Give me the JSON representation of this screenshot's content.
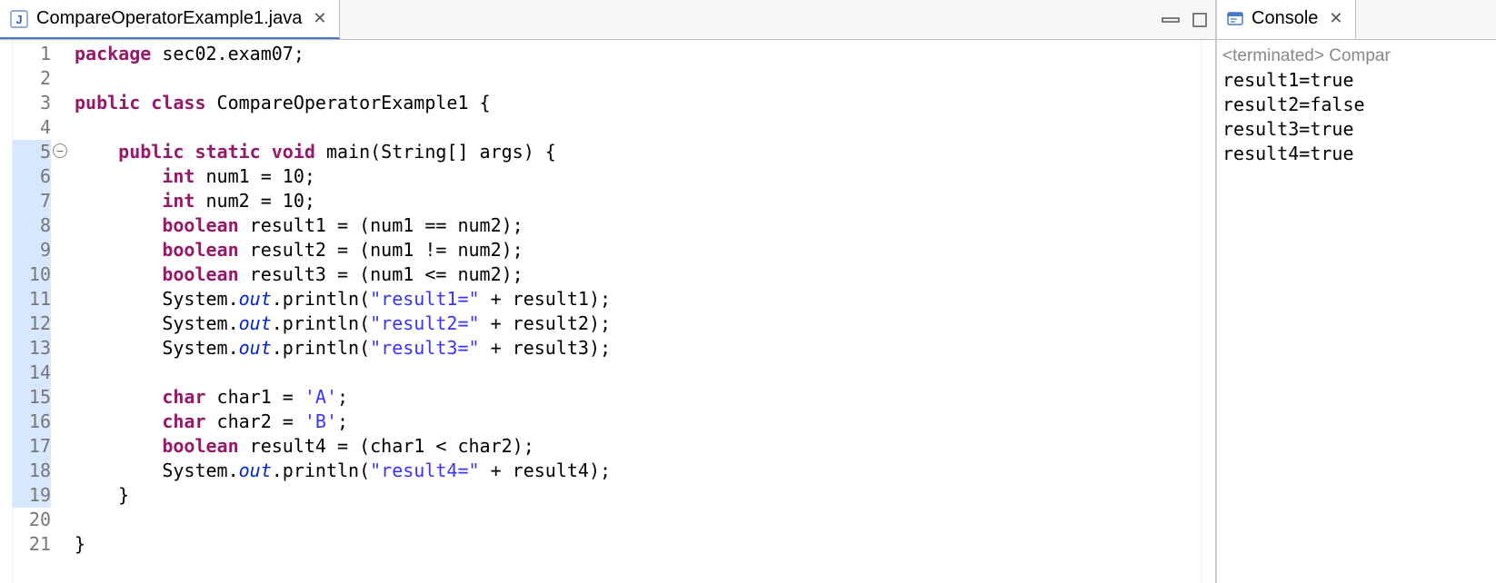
{
  "editor": {
    "tab": {
      "label": "CompareOperatorExample1.java"
    },
    "lines": [
      {
        "n": "1"
      },
      {
        "n": "2"
      },
      {
        "n": "3"
      },
      {
        "n": "4"
      },
      {
        "n": "5"
      },
      {
        "n": "6"
      },
      {
        "n": "7"
      },
      {
        "n": "8"
      },
      {
        "n": "9"
      },
      {
        "n": "10"
      },
      {
        "n": "11"
      },
      {
        "n": "12"
      },
      {
        "n": "13"
      },
      {
        "n": "14"
      },
      {
        "n": "15"
      },
      {
        "n": "16"
      },
      {
        "n": "17"
      },
      {
        "n": "18"
      },
      {
        "n": "19"
      },
      {
        "n": "20"
      },
      {
        "n": "21"
      }
    ],
    "code": {
      "l1_kw1": "package",
      "l1_rest": " sec02.exam07;",
      "l3_kw1": "public",
      "l3_kw2": "class",
      "l3_rest": " CompareOperatorExample1 {",
      "l5_kw1": "public",
      "l5_kw2": "static",
      "l5_kw3": "void",
      "l5_m": " main(String[] args) {",
      "l6_kw": "int",
      "l6_rest": " num1 = 10;",
      "l7_kw": "int",
      "l7_rest": " num2 = 10;",
      "l8_kw": "boolean",
      "l8_rest": " result1 = (num1 == num2);",
      "l9_kw": "boolean",
      "l9_rest": " result2 = (num1 != num2);",
      "l10_kw": "boolean",
      "l10_rest": " result3 = (num1 <= num2);",
      "l11_a": "        System.",
      "l11_out": "out",
      "l11_b": ".println(",
      "l11_s": "\"result1=\"",
      "l11_c": " + result1);",
      "l12_a": "        System.",
      "l12_out": "out",
      "l12_b": ".println(",
      "l12_s": "\"result2=\"",
      "l12_c": " + result2);",
      "l13_a": "        System.",
      "l13_out": "out",
      "l13_b": ".println(",
      "l13_s": "\"result3=\"",
      "l13_c": " + result3);",
      "l15_kw": "char",
      "l15_rest_a": " char1 = ",
      "l15_s": "'A'",
      "l15_rest_b": ";",
      "l16_kw": "char",
      "l16_rest_a": " char2 = ",
      "l16_s": "'B'",
      "l16_rest_b": ";",
      "l17_kw": "boolean",
      "l17_rest": " result4 = (char1 < char2);",
      "l18_a": "        System.",
      "l18_out": "out",
      "l18_b": ".println(",
      "l18_s": "\"result4=\"",
      "l18_c": " + result4);",
      "l19": "    }",
      "l21": "}"
    }
  },
  "console": {
    "tab": {
      "label": "Console"
    },
    "status": "<terminated> Compar",
    "output": [
      "result1=true",
      "result2=false",
      "result3=true",
      "result4=true"
    ]
  }
}
